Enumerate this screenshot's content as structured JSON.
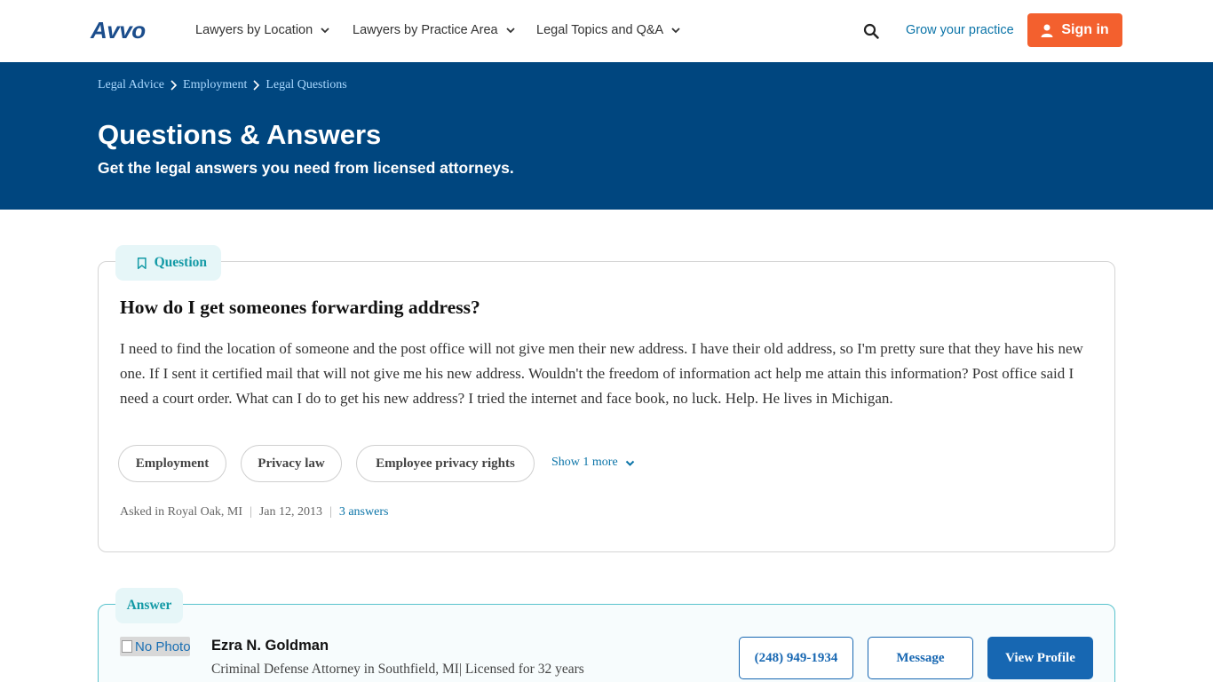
{
  "header": {
    "logo": "Avvo",
    "nav": [
      "Lawyers by Location",
      "Lawyers by Practice Area",
      "Legal Topics and Q&A"
    ],
    "grow": "Grow your practice",
    "signin": "Sign in"
  },
  "hero": {
    "breadcrumbs": [
      "Legal Advice",
      "Employment",
      "Legal Questions"
    ],
    "title": "Questions & Answers",
    "subtitle": "Get the legal answers you need from licensed attorneys."
  },
  "question": {
    "badge": "Question",
    "title": "How do I get someones forwarding address?",
    "body": "I need to find the location of someone and the post office will not give men their new address. I have their old address, so I'm pretty sure that they have his new one. If I sent it certified mail that will not give me his new address. Wouldn't the freedom of information act help me attain this information? Post office said I need a court order. What can I do to get his new address? I tried the internet and face book, no luck. Help. He lives in Michigan.",
    "tags": [
      "Employment",
      "Privacy law",
      "Employee privacy rights"
    ],
    "show_more": "Show 1 more",
    "asked": "Asked in Royal Oak, MI",
    "date": "Jan 12, 2013",
    "answers": "3 answers"
  },
  "answer": {
    "badge": "Answer",
    "photo_alt": "No Photo",
    "name": "Ezra N. Goldman",
    "desc": "Criminal Defense Attorney in Southfield, MI| Licensed for 32 years",
    "phone": "(248) 949-1934",
    "message": "Message",
    "view_profile": "View Profile"
  },
  "colors": {
    "hero_bg": "#00467f",
    "signin_bg": "#f3602e",
    "accent_link": "#0b74a8",
    "badge_text": "#139aa6",
    "answer_border": "#59c3cd",
    "button_blue": "#1767b2"
  }
}
